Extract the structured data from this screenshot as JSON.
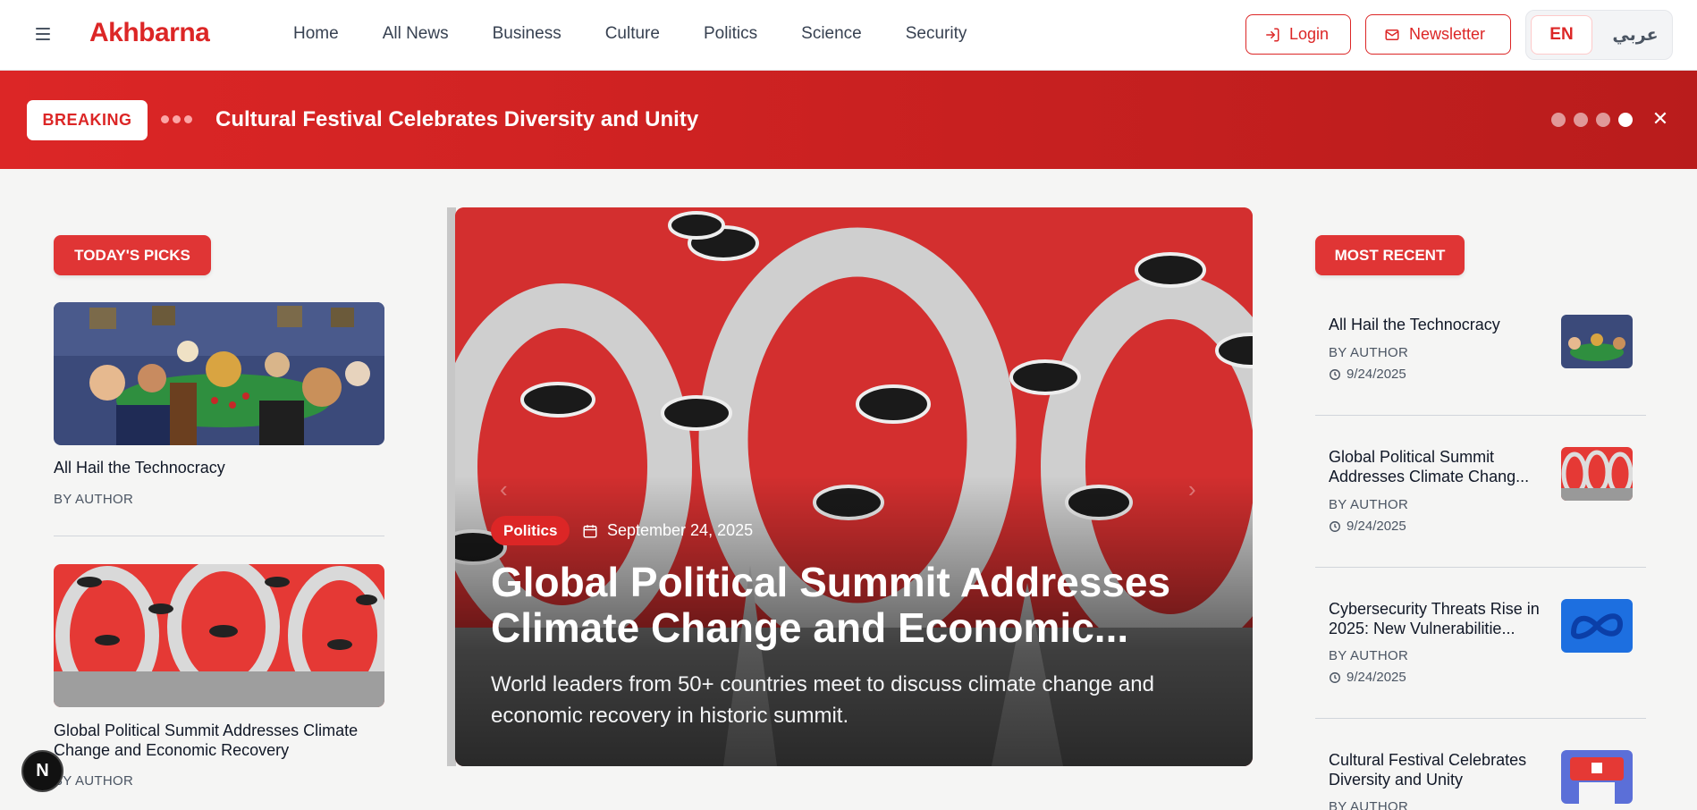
{
  "header": {
    "logo": "Akhbarna",
    "nav": [
      "Home",
      "All News",
      "Business",
      "Culture",
      "Politics",
      "Science",
      "Security"
    ],
    "login_label": "Login",
    "newsletter_label": "Newsletter",
    "lang_en": "EN",
    "lang_ar": "عربي"
  },
  "breaking": {
    "label": "BREAKING",
    "headline": "Cultural Festival Celebrates Diversity and Unity"
  },
  "todays_picks": {
    "heading": "TODAY'S PICKS",
    "items": [
      {
        "title": "All Hail the Technocracy",
        "author": "BY AUTHOR"
      },
      {
        "title": "Global Political Summit Addresses Climate Change and Economic Recovery",
        "author": "BY AUTHOR"
      }
    ]
  },
  "hero": {
    "category": "Politics",
    "date": "September 24, 2025",
    "title": "Global Political Summit Addresses Climate Change and Economic...",
    "description": "World leaders from 50+ countries meet to discuss climate change and economic recovery in historic summit."
  },
  "most_recent": {
    "heading": "MOST RECENT",
    "items": [
      {
        "title": "All Hail the Technocracy",
        "author": "BY AUTHOR",
        "date": "9/24/2025"
      },
      {
        "title": "Global Political Summit Addresses Climate Chang...",
        "author": "BY AUTHOR",
        "date": "9/24/2025"
      },
      {
        "title": "Cybersecurity Threats Rise in 2025: New Vulnerabilitie...",
        "author": "BY AUTHOR",
        "date": "9/24/2025"
      },
      {
        "title": "Cultural Festival Celebrates Diversity and Unity",
        "author": "BY AUTHOR"
      }
    ]
  },
  "badge": "N",
  "colors": {
    "brand": "#dc2626",
    "background": "#f5f5f4"
  }
}
